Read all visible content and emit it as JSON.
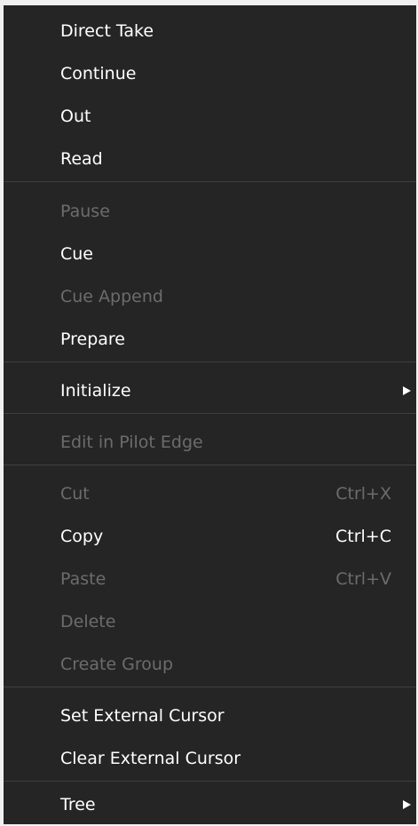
{
  "menu": {
    "items": [
      {
        "label": "Direct Take"
      },
      {
        "label": "Continue"
      },
      {
        "label": "Out"
      },
      {
        "label": "Read"
      },
      {
        "label": "Pause"
      },
      {
        "label": "Cue"
      },
      {
        "label": "Cue Append"
      },
      {
        "label": "Prepare"
      },
      {
        "label": "Initialize"
      },
      {
        "label": "Edit in Pilot Edge"
      },
      {
        "label": "Cut",
        "shortcut": "Ctrl+X"
      },
      {
        "label": "Copy",
        "shortcut": "Ctrl+C"
      },
      {
        "label": "Paste",
        "shortcut": "Ctrl+V"
      },
      {
        "label": "Delete"
      },
      {
        "label": "Create Group"
      },
      {
        "label": "Set External Cursor"
      },
      {
        "label": "Clear External Cursor"
      },
      {
        "label": "Tree"
      }
    ],
    "submenu_icon": "triangle-right-icon",
    "colors": {
      "background": "#252526",
      "text": "#ffffff",
      "disabled_text": "#6c6c6c",
      "separator": "#3f3f3f"
    }
  }
}
